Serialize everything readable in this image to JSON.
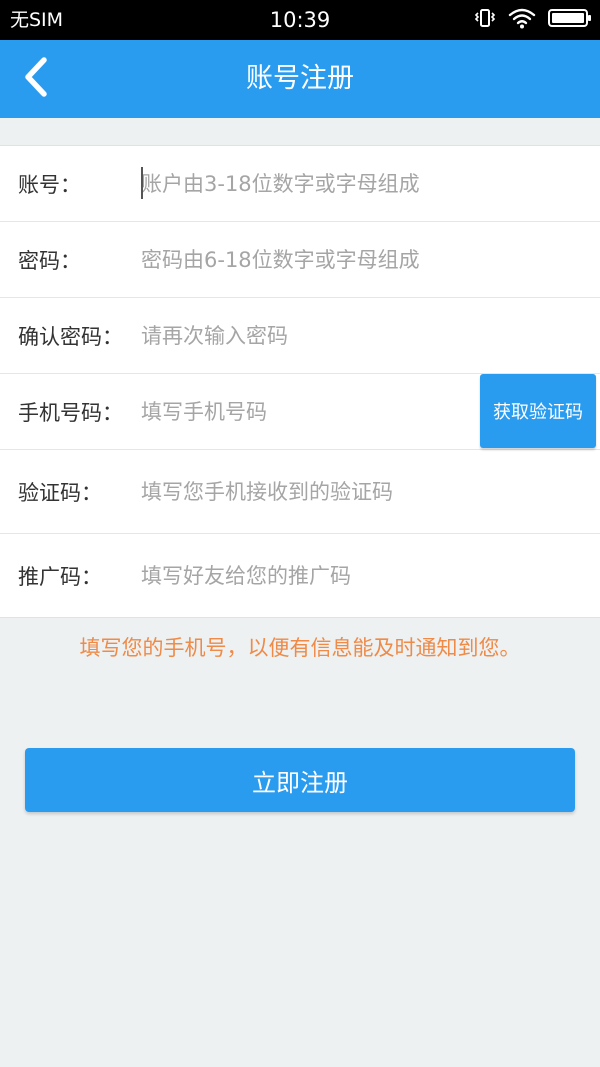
{
  "status_bar": {
    "carrier": "无SIM",
    "time": "10:39",
    "icons": [
      "vibrate-icon",
      "wifi-icon",
      "battery-icon"
    ]
  },
  "app_bar": {
    "title": "账号注册",
    "back_icon": "chevron-left-icon"
  },
  "form": {
    "account": {
      "label": "账号：",
      "placeholder": "账户由3-18位数字或字母组成",
      "value": ""
    },
    "password": {
      "label": "密码：",
      "placeholder": "密码由6-18位数字或字母组成",
      "value": ""
    },
    "confirm_password": {
      "label": "确认密码：",
      "placeholder": "请再次输入密码",
      "value": ""
    },
    "phone": {
      "label": "手机号码：",
      "placeholder": "填写手机号码",
      "value": "",
      "get_code_label": "获取验证码"
    },
    "verification_code": {
      "label": "验证码：",
      "placeholder": "填写您手机接收到的验证码",
      "value": ""
    },
    "referral_code": {
      "label": "推广码：",
      "placeholder": "填写好友给您的推广码",
      "value": ""
    }
  },
  "tip": "填写您的手机号，以便有信息能及时通知到您。",
  "register_button_label": "立即注册",
  "colors": {
    "primary": "#2a9cf0",
    "tip": "#ef8a47",
    "background": "#eef1f2"
  }
}
